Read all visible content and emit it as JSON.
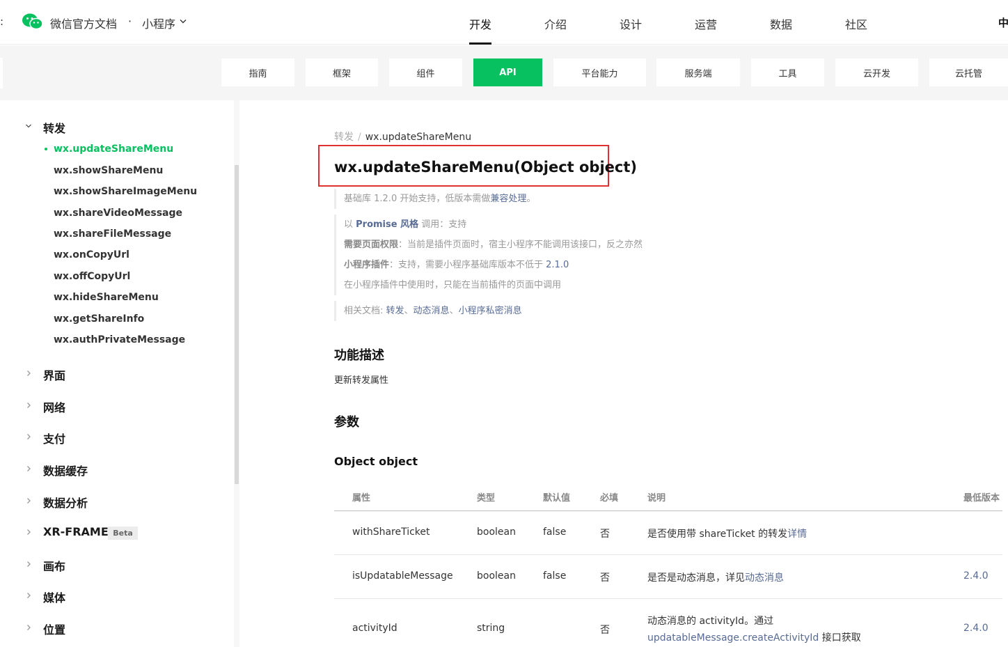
{
  "header": {
    "left_fragment": ":",
    "brand": "微信官方文档",
    "brand_sep": "·",
    "brand_sub": "小程序",
    "nav": [
      {
        "label": "开发",
        "active": true
      },
      {
        "label": "介绍",
        "active": false
      },
      {
        "label": "设计",
        "active": false
      },
      {
        "label": "运营",
        "active": false
      },
      {
        "label": "数据",
        "active": false
      },
      {
        "label": "社区",
        "active": false
      }
    ],
    "right_fragment": "中"
  },
  "subnav": [
    {
      "label": "指南"
    },
    {
      "label": "框架"
    },
    {
      "label": "组件"
    },
    {
      "label": "API",
      "active": true
    },
    {
      "label": "平台能力"
    },
    {
      "label": "服务端"
    },
    {
      "label": "工具"
    },
    {
      "label": "云开发"
    },
    {
      "label": "云托管"
    }
  ],
  "sidebar": {
    "open_group": "转发",
    "items": [
      "wx.updateShareMenu",
      "wx.showShareMenu",
      "wx.showShareImageMenu",
      "wx.shareVideoMessage",
      "wx.shareFileMessage",
      "wx.onCopyUrl",
      "wx.offCopyUrl",
      "wx.hideShareMenu",
      "wx.getShareInfo",
      "wx.authPrivateMessage"
    ],
    "groups": [
      "界面",
      "网络",
      "支付",
      "数据缓存",
      "数据分析",
      "XR-FRAME",
      "画布",
      "媒体",
      "位置"
    ],
    "beta_badge": "Beta"
  },
  "content": {
    "breadcrumb": {
      "parent": "转发",
      "sep": "/",
      "current": "wx.updateShareMenu"
    },
    "title": "wx.updateShareMenu(Object object)",
    "support": {
      "text": "基础库 1.2.0 开始支持，低版本需做",
      "link": "兼容处理",
      "tail": "。"
    },
    "promise": {
      "prefix": "以 ",
      "link": "Promise 风格",
      "suffix": " 调用：支持"
    },
    "perm": {
      "label": "需要页面权限",
      "text": "：当前是插件页面时，宿主小程序不能调用该接口，反之亦然"
    },
    "plugin": {
      "label": "小程序插件",
      "text": "：支持，需要小程序基础库版本不低于 ",
      "version": "2.1.0"
    },
    "plugin_note": "在小程序插件中使用时，只能在当前插件的页面中调用",
    "related": {
      "label": "相关文档: ",
      "links": [
        "转发",
        "动态消息",
        "小程序私密消息"
      ],
      "sep": "、"
    },
    "section_desc": "功能描述",
    "desc_text": "更新转发属性",
    "section_params": "参数",
    "section_object": "Object object"
  },
  "table": {
    "headers": [
      "属性",
      "类型",
      "默认值",
      "必填",
      "说明",
      "最低版本"
    ],
    "rows": [
      {
        "name": "withShareTicket",
        "type": "boolean",
        "default": "false",
        "required": "否",
        "desc": "是否使用带 shareTicket 的转发",
        "desc_link": "详情",
        "version": ""
      },
      {
        "name": "isUpdatableMessage",
        "type": "boolean",
        "default": "false",
        "required": "否",
        "desc": "是否是动态消息，详见",
        "desc_link": "动态消息",
        "version": "2.4.0"
      },
      {
        "name": "activityId",
        "type": "string",
        "default": "",
        "required": "否",
        "desc": "动态消息的 activityId。通过",
        "desc_link": "updatableMessage.createActivityId",
        "desc_tail": " 接口获取",
        "version": "2.4.0"
      }
    ]
  },
  "colors": {
    "accent": "#07c160",
    "link": "#576b95",
    "highlight_box": "#e03030"
  }
}
